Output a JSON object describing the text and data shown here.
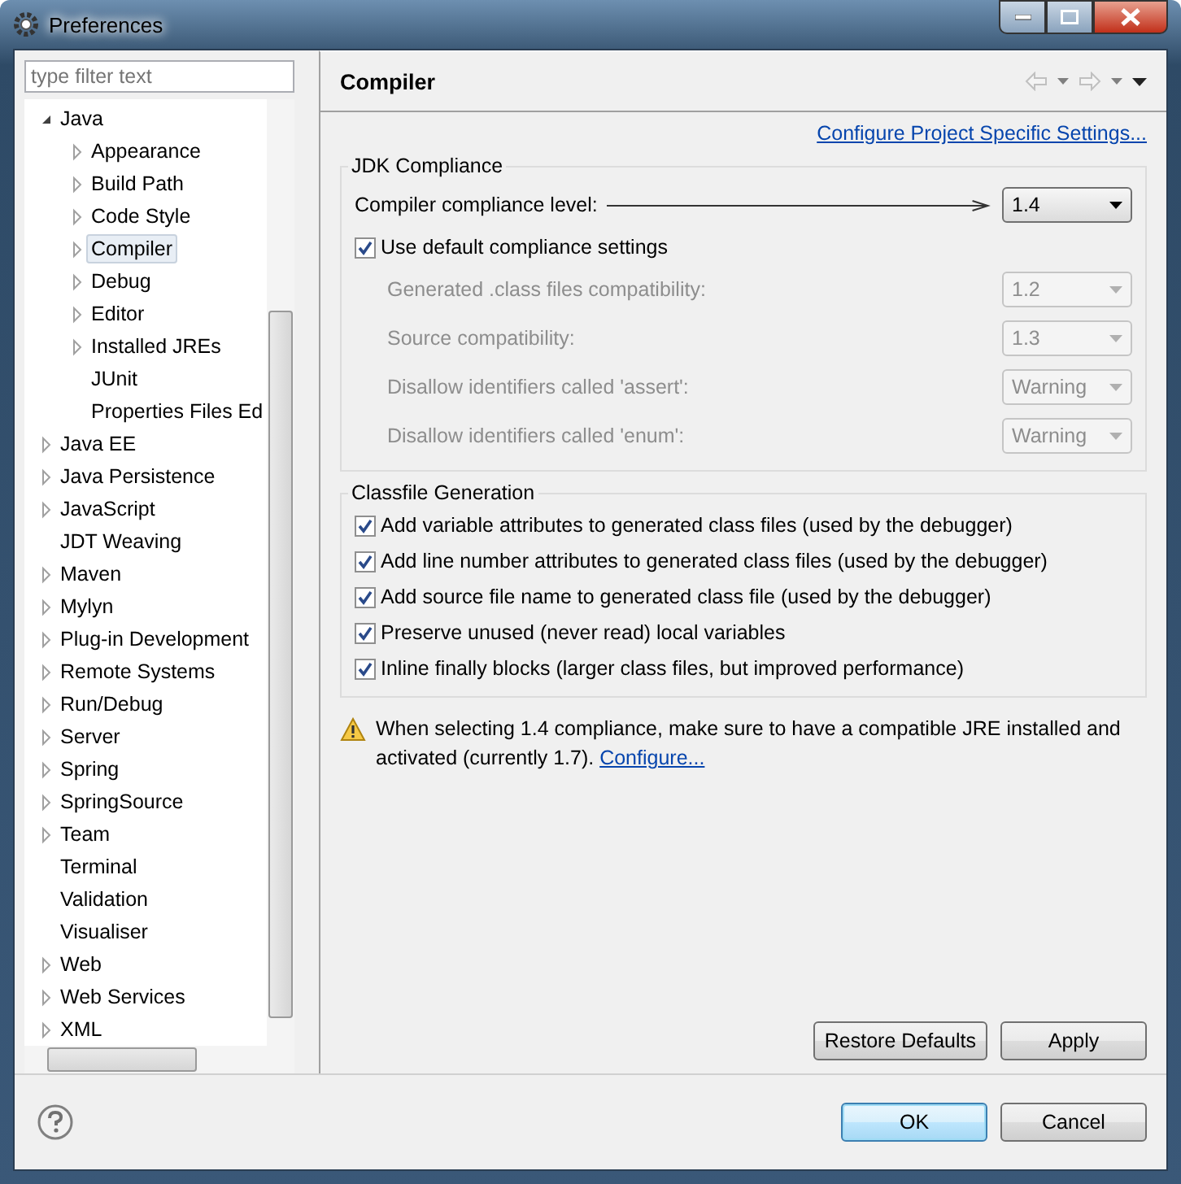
{
  "window": {
    "title": "Preferences"
  },
  "filter": {
    "placeholder": "type filter text"
  },
  "tree": [
    {
      "label": "Java",
      "kind": "branch",
      "expanded": true,
      "selected": false,
      "children": [
        {
          "label": "Appearance",
          "kind": "branch",
          "expanded": false,
          "selected": false
        },
        {
          "label": "Build Path",
          "kind": "branch",
          "expanded": false,
          "selected": false
        },
        {
          "label": "Code Style",
          "kind": "branch",
          "expanded": false,
          "selected": false
        },
        {
          "label": "Compiler",
          "kind": "branch",
          "expanded": false,
          "selected": true
        },
        {
          "label": "Debug",
          "kind": "branch",
          "expanded": false,
          "selected": false
        },
        {
          "label": "Editor",
          "kind": "branch",
          "expanded": false,
          "selected": false
        },
        {
          "label": "Installed JREs",
          "kind": "branch",
          "expanded": false,
          "selected": false
        },
        {
          "label": "JUnit",
          "kind": "leaf",
          "selected": false
        },
        {
          "label": "Properties Files Ed",
          "kind": "leaf",
          "selected": false
        }
      ]
    },
    {
      "label": "Java EE",
      "kind": "branch",
      "expanded": false,
      "selected": false
    },
    {
      "label": "Java Persistence",
      "kind": "branch",
      "expanded": false,
      "selected": false
    },
    {
      "label": "JavaScript",
      "kind": "branch",
      "expanded": false,
      "selected": false
    },
    {
      "label": "JDT Weaving",
      "kind": "leaf",
      "selected": false
    },
    {
      "label": "Maven",
      "kind": "branch",
      "expanded": false,
      "selected": false
    },
    {
      "label": "Mylyn",
      "kind": "branch",
      "expanded": false,
      "selected": false
    },
    {
      "label": "Plug-in Development",
      "kind": "branch",
      "expanded": false,
      "selected": false
    },
    {
      "label": "Remote Systems",
      "kind": "branch",
      "expanded": false,
      "selected": false
    },
    {
      "label": "Run/Debug",
      "kind": "branch",
      "expanded": false,
      "selected": false
    },
    {
      "label": "Server",
      "kind": "branch",
      "expanded": false,
      "selected": false
    },
    {
      "label": "Spring",
      "kind": "branch",
      "expanded": false,
      "selected": false
    },
    {
      "label": "SpringSource",
      "kind": "branch",
      "expanded": false,
      "selected": false
    },
    {
      "label": "Team",
      "kind": "branch",
      "expanded": false,
      "selected": false
    },
    {
      "label": "Terminal",
      "kind": "leaf",
      "selected": false
    },
    {
      "label": "Validation",
      "kind": "leaf",
      "selected": false
    },
    {
      "label": "Visualiser",
      "kind": "leaf",
      "selected": false
    },
    {
      "label": "Web",
      "kind": "branch",
      "expanded": false,
      "selected": false
    },
    {
      "label": "Web Services",
      "kind": "branch",
      "expanded": false,
      "selected": false
    },
    {
      "label": "XML",
      "kind": "branch",
      "expanded": false,
      "selected": false
    }
  ],
  "page": {
    "title": "Compiler",
    "link": "Configure Project Specific Settings...",
    "jdk_group": {
      "title": "JDK Compliance",
      "compliance_label": "Compiler compliance level:",
      "compliance_value": "1.4",
      "default_checkbox": {
        "label": "Use default compliance settings",
        "checked": true
      },
      "settings": [
        {
          "label": "Generated .class files compatibility:",
          "value": "1.2",
          "disabled": true
        },
        {
          "label": "Source compatibility:",
          "value": "1.3",
          "disabled": true
        },
        {
          "label": "Disallow identifiers called 'assert':",
          "value": "Warning",
          "disabled": true
        },
        {
          "label": "Disallow identifiers called 'enum':",
          "value": "Warning",
          "disabled": true
        }
      ]
    },
    "classfile_group": {
      "title": "Classfile Generation",
      "options": [
        {
          "label": "Add variable attributes to generated class files (used by the debugger)",
          "checked": true
        },
        {
          "label": "Add line number attributes to generated class files (used by the debugger)",
          "checked": true
        },
        {
          "label": "Add source file name to generated class file (used by the debugger)",
          "checked": true
        },
        {
          "label": "Preserve unused (never read) local variables",
          "checked": true
        },
        {
          "label": "Inline finally blocks (larger class files, but improved performance)",
          "checked": true
        }
      ]
    },
    "warning": {
      "text": "When selecting 1.4 compliance, make sure to have a compatible JRE installed and activated (currently 1.7).",
      "link": "Configure..."
    },
    "buttons": [
      "Restore Defaults",
      "Apply"
    ]
  },
  "dialog_buttons": [
    {
      "label": "OK",
      "default": true
    },
    {
      "label": "Cancel",
      "default": false
    }
  ]
}
